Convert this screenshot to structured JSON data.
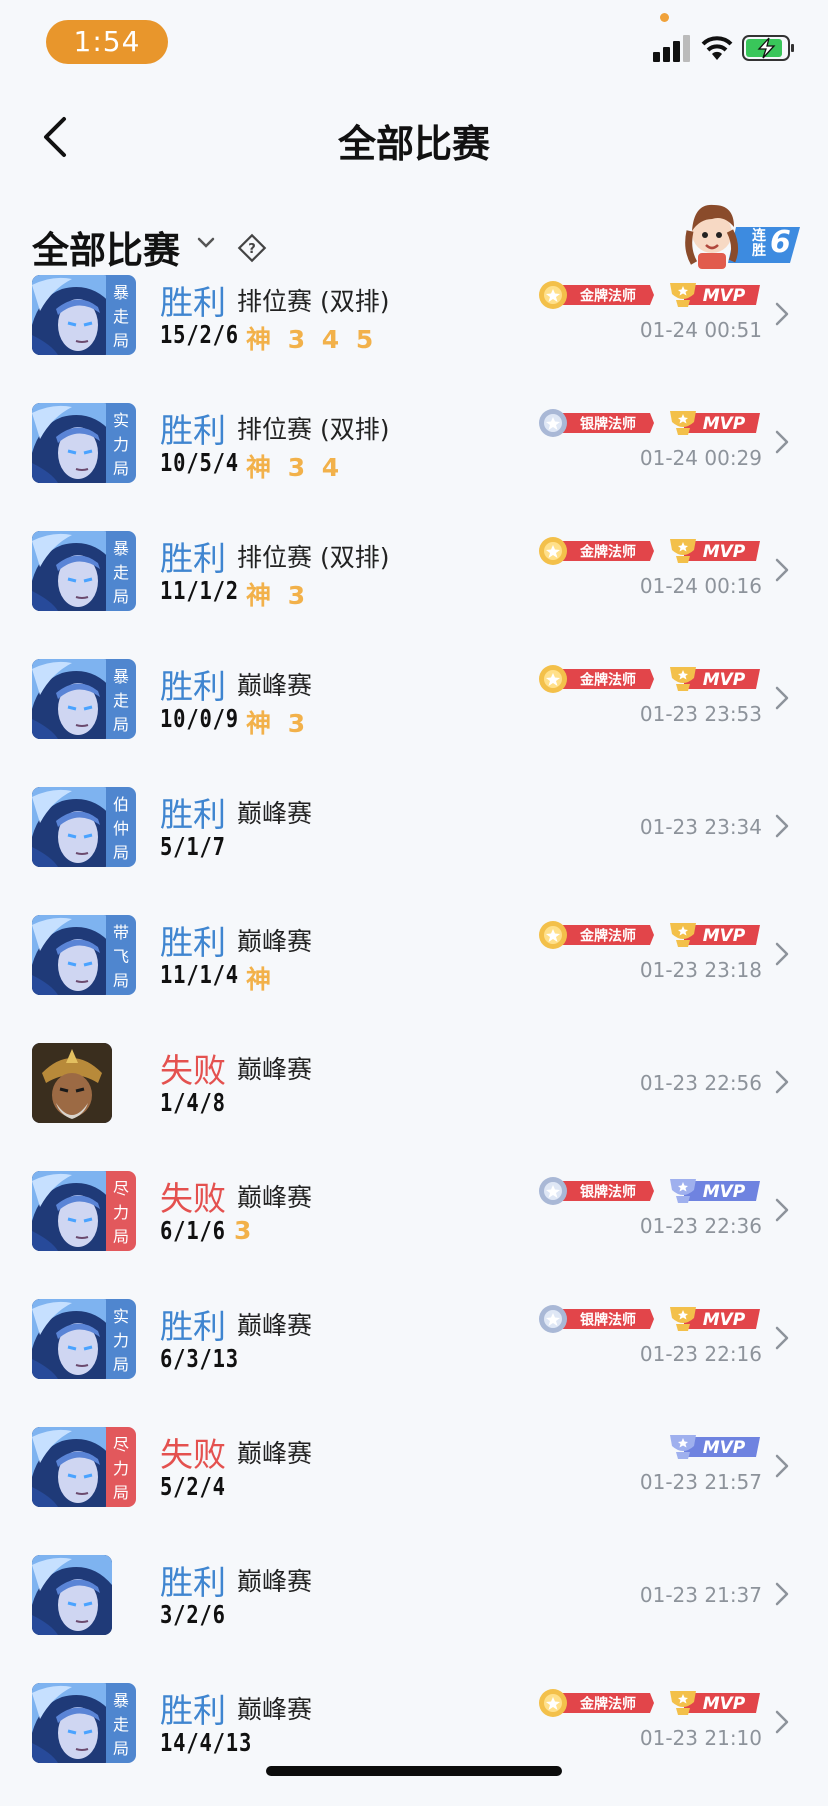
{
  "status_bar": {
    "time": "1:54"
  },
  "nav": {
    "title": "全部比赛"
  },
  "filter": {
    "label": "全部比赛",
    "streak_line1": "连",
    "streak_line2": "胜",
    "streak_count": "6"
  },
  "matches": [
    {
      "result": "胜利",
      "win": true,
      "mode": "排位赛 (双排)",
      "kda": "15/2/6",
      "extras": "神 3 4 5",
      "time": "01-24 00:51",
      "tag": [
        "暴",
        "走",
        "局"
      ],
      "tag_color": "blue",
      "medal": "金牌法师",
      "medal_type": "gold",
      "mvp": "MVP",
      "mvp_type": "gold",
      "hero": "mage"
    },
    {
      "result": "胜利",
      "win": true,
      "mode": "排位赛 (双排)",
      "kda": "10/5/4",
      "extras": "神 3 4",
      "time": "01-24 00:29",
      "tag": [
        "实",
        "力",
        "局"
      ],
      "tag_color": "blue",
      "medal": "银牌法师",
      "medal_type": "silver",
      "mvp": "MVP",
      "mvp_type": "gold",
      "hero": "mage"
    },
    {
      "result": "胜利",
      "win": true,
      "mode": "排位赛 (双排)",
      "kda": "11/1/2",
      "extras": "神 3",
      "time": "01-24 00:16",
      "tag": [
        "暴",
        "走",
        "局"
      ],
      "tag_color": "blue",
      "medal": "金牌法师",
      "medal_type": "gold",
      "mvp": "MVP",
      "mvp_type": "gold",
      "hero": "mage"
    },
    {
      "result": "胜利",
      "win": true,
      "mode": "巅峰赛",
      "kda": "10/0/9",
      "extras": "神 3",
      "time": "01-23 23:53",
      "tag": [
        "暴",
        "走",
        "局"
      ],
      "tag_color": "blue",
      "medal": "金牌法师",
      "medal_type": "gold",
      "mvp": "MVP",
      "mvp_type": "gold",
      "hero": "mage"
    },
    {
      "result": "胜利",
      "win": true,
      "mode": "巅峰赛",
      "kda": "5/1/7",
      "extras": "",
      "time": "01-23 23:34",
      "tag": [
        "伯",
        "仲",
        "局"
      ],
      "tag_color": "blue",
      "medal": "",
      "medal_type": "",
      "mvp": "",
      "mvp_type": "",
      "hero": "mage"
    },
    {
      "result": "胜利",
      "win": true,
      "mode": "巅峰赛",
      "kda": "11/1/4",
      "extras": "神",
      "time": "01-23 23:18",
      "tag": [
        "带",
        "飞",
        "局"
      ],
      "tag_color": "blue",
      "medal": "金牌法师",
      "medal_type": "gold",
      "mvp": "MVP",
      "mvp_type": "gold",
      "hero": "mage"
    },
    {
      "result": "失败",
      "win": false,
      "mode": "巅峰赛",
      "kda": "1/4/8",
      "extras": "",
      "time": "01-23 22:56",
      "tag": [],
      "tag_color": "",
      "medal": "",
      "medal_type": "",
      "mvp": "",
      "mvp_type": "",
      "hero": "warrior"
    },
    {
      "result": "失败",
      "win": false,
      "mode": "巅峰赛",
      "kda": "6/1/6",
      "extras": "3",
      "time": "01-23 22:36",
      "tag": [
        "尽",
        "力",
        "局"
      ],
      "tag_color": "red",
      "medal": "银牌法师",
      "medal_type": "silver",
      "mvp": "MVP",
      "mvp_type": "silver",
      "hero": "mage"
    },
    {
      "result": "胜利",
      "win": true,
      "mode": "巅峰赛",
      "kda": "6/3/13",
      "extras": "",
      "time": "01-23 22:16",
      "tag": [
        "实",
        "力",
        "局"
      ],
      "tag_color": "blue",
      "medal": "银牌法师",
      "medal_type": "silver",
      "mvp": "MVP",
      "mvp_type": "gold",
      "hero": "mage"
    },
    {
      "result": "失败",
      "win": false,
      "mode": "巅峰赛",
      "kda": "5/2/4",
      "extras": "",
      "time": "01-23 21:57",
      "tag": [
        "尽",
        "力",
        "局"
      ],
      "tag_color": "red",
      "medal": "",
      "medal_type": "",
      "mvp": "MVP",
      "mvp_type": "silver",
      "hero": "mage"
    },
    {
      "result": "胜利",
      "win": true,
      "mode": "巅峰赛",
      "kda": "3/2/6",
      "extras": "",
      "time": "01-23 21:37",
      "tag": [],
      "tag_color": "",
      "medal": "",
      "medal_type": "",
      "mvp": "",
      "mvp_type": "",
      "hero": "mage"
    },
    {
      "result": "胜利",
      "win": true,
      "mode": "巅峰赛",
      "kda": "14/4/13",
      "extras": "",
      "time": "01-23 21:10",
      "tag": [
        "暴",
        "走",
        "局"
      ],
      "tag_color": "blue",
      "medal": "金牌法师",
      "medal_type": "gold",
      "mvp": "MVP",
      "mvp_type": "gold",
      "hero": "mage"
    }
  ],
  "colors": {
    "win": "#3f85d0",
    "lose": "#e4514f",
    "gold": "#f2b14a",
    "badge_red": "#e2454a",
    "mvp_silver": "#6f83e0"
  }
}
